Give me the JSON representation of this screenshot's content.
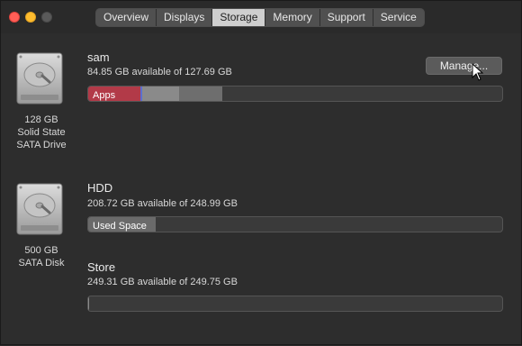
{
  "tabs": [
    {
      "label": "Overview",
      "active": false
    },
    {
      "label": "Displays",
      "active": false
    },
    {
      "label": "Storage",
      "active": true
    },
    {
      "label": "Memory",
      "active": false
    },
    {
      "label": "Support",
      "active": false
    },
    {
      "label": "Service",
      "active": false
    }
  ],
  "disks": [
    {
      "icon": "hard-drive-icon",
      "caption": [
        "128 GB",
        "Solid State",
        "SATA Drive"
      ]
    },
    {
      "icon": "hard-drive-icon",
      "caption": [
        "500 GB",
        "SATA Disk"
      ]
    }
  ],
  "volumes": [
    {
      "name": "sam",
      "available": "84.85 GB available of 127.69 GB",
      "segments": [
        {
          "label": "Apps",
          "fraction": 0.125,
          "color": "#b23a48"
        },
        {
          "label": "",
          "fraction": 0.005,
          "color": "#5b6fd0"
        },
        {
          "label": "",
          "fraction": 0.09,
          "color": "#8a8a8a"
        },
        {
          "label": "",
          "fraction": 0.105,
          "color": "#6e6e6e"
        }
      ]
    },
    {
      "name": "HDD",
      "available": "208.72 GB available of 248.99 GB",
      "segments": [
        {
          "label": "Used Space",
          "fraction": 0.162,
          "color": "#6a6a6a"
        }
      ]
    },
    {
      "name": "Store",
      "available": "249.31 GB available of 249.75 GB",
      "segments": [
        {
          "label": "",
          "fraction": 0.002,
          "color": "#8a8a8a"
        }
      ]
    }
  ],
  "manage_button": {
    "label": "Manage..."
  },
  "colors": {
    "window_bg": "#2d2d2d",
    "active_tab": "#cfcfcf"
  }
}
